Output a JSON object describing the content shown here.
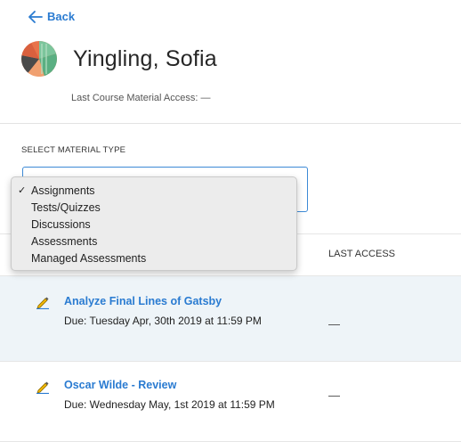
{
  "back": {
    "label": "Back"
  },
  "student": {
    "name": "Yingling, Sofia",
    "last_access_text": "Last Course Material Access: —"
  },
  "material_select": {
    "label": "SELECT MATERIAL TYPE",
    "selected": "Assignments",
    "options": [
      "Assignments",
      "Tests/Quizzes",
      "Discussions",
      "Assessments",
      "Managed Assessments"
    ]
  },
  "table": {
    "columns": {
      "last_access": "LAST ACCESS"
    },
    "rows": [
      {
        "title": "Analyze Final Lines of Gatsby",
        "due": "Due: Tuesday Apr, 30th 2019 at 11:59 PM",
        "last_access": "—",
        "icon": "pencil-icon"
      },
      {
        "title": "Oscar Wilde - Review",
        "due": "Due: Wednesday May, 1st 2019 at 11:59 PM",
        "last_access": "—",
        "icon": "pencil-icon"
      }
    ]
  },
  "colors": {
    "accent": "#2a7bd1",
    "row_highlight": "#eef4f8"
  }
}
